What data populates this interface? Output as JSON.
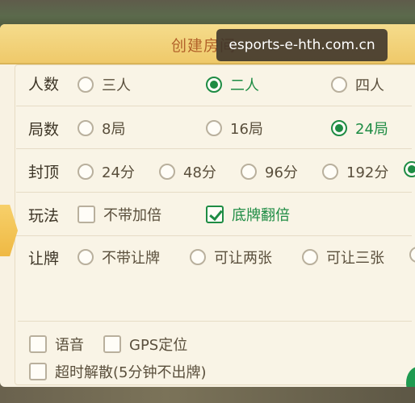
{
  "dialog": {
    "title": "创建房间"
  },
  "watermark": "esports-e-hth.com.cn",
  "rows": {
    "players": {
      "label": "人数",
      "options": [
        "三人",
        "二人",
        "四人"
      ],
      "selected": "二人"
    },
    "rounds": {
      "label": "局数",
      "options": [
        "8局",
        "16局",
        "24局"
      ],
      "selected": "24局"
    },
    "cap": {
      "label": "封顶",
      "options": [
        "24分",
        "48分",
        "96分",
        "192分"
      ]
    },
    "rules": {
      "label": "玩法",
      "options": [
        "不带加倍",
        "底牌翻倍"
      ],
      "checked": [
        "底牌翻倍"
      ]
    },
    "concede": {
      "label": "让牌",
      "options": [
        "不带让牌",
        "可让两张",
        "可让三张"
      ]
    }
  },
  "footer": {
    "voice": "语音",
    "gps": "GPS定位",
    "timeout": "超时解散(5分钟不出牌)"
  },
  "colors": {
    "selected": "#1e8c44",
    "title": "#b2622a",
    "header": "#efc96a"
  }
}
